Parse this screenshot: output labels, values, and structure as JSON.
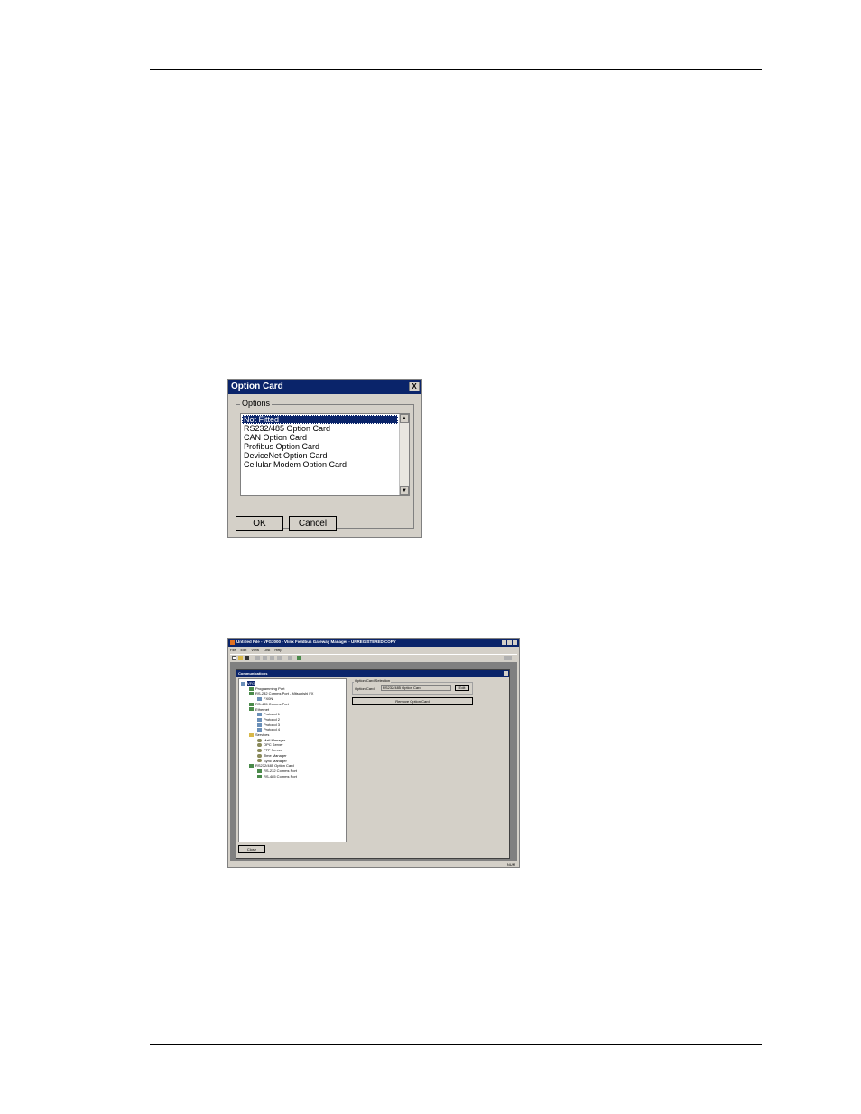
{
  "option_dialog": {
    "title": "Option Card",
    "close_glyph": "X",
    "group_label": "Options",
    "items": [
      "Not Fitted",
      "RS232/485 Option Card",
      "CAN Option Card",
      "Profibus Option Card",
      "DeviceNet Option Card",
      "Cellular Modem Option Card"
    ],
    "selected_index": 0,
    "ok_label": "OK",
    "cancel_label": "Cancel",
    "scroll_up_icon": "▲",
    "scroll_down_icon": "▼"
  },
  "app_window": {
    "title": "Untitled File - VFG3000 - Vlinx Fieldbus Gateway Manager - UNREGISTERED COPY",
    "menu": [
      "File",
      "Edit",
      "View",
      "Link",
      "Help"
    ],
    "panel_title": "Communications",
    "tree": [
      {
        "label": "VFG",
        "depth": 0,
        "icon": "device"
      },
      {
        "label": "Programming Port",
        "depth": 1,
        "icon": "plug"
      },
      {
        "label": "RS-232 Comms Port - Mitsubishi FX",
        "depth": 1,
        "icon": "plug"
      },
      {
        "label": "FX0N",
        "depth": 2,
        "icon": "device"
      },
      {
        "label": "RS-485 Comms Port",
        "depth": 1,
        "icon": "plug"
      },
      {
        "label": "Ethernet",
        "depth": 1,
        "icon": "plug"
      },
      {
        "label": "Protocol 1",
        "depth": 2,
        "icon": "device"
      },
      {
        "label": "Protocol 2",
        "depth": 2,
        "icon": "device"
      },
      {
        "label": "Protocol 3",
        "depth": 2,
        "icon": "device"
      },
      {
        "label": "Protocol 4",
        "depth": 2,
        "icon": "device"
      },
      {
        "label": "Services",
        "depth": 1,
        "icon": "folder"
      },
      {
        "label": "Mail Manager",
        "depth": 2,
        "icon": "gear"
      },
      {
        "label": "OPC Server",
        "depth": 2,
        "icon": "gear"
      },
      {
        "label": "FTP Server",
        "depth": 2,
        "icon": "gear"
      },
      {
        "label": "Time Manager",
        "depth": 2,
        "icon": "gear"
      },
      {
        "label": "Sync Manager",
        "depth": 2,
        "icon": "gear"
      },
      {
        "label": "RS232/485 Option Card",
        "depth": 1,
        "icon": "plug"
      },
      {
        "label": "RS-232 Comms Port",
        "depth": 2,
        "icon": "plug"
      },
      {
        "label": "RS-485 Comms Port",
        "depth": 2,
        "icon": "plug"
      }
    ],
    "group_label": "Option Card Selection",
    "field_label": "Option Card:",
    "field_value": "RS232/485 Option Card",
    "edit_label": "Edit",
    "remove_label": "Remove Option Card",
    "close_label": "Close",
    "status_text": "NUM"
  }
}
